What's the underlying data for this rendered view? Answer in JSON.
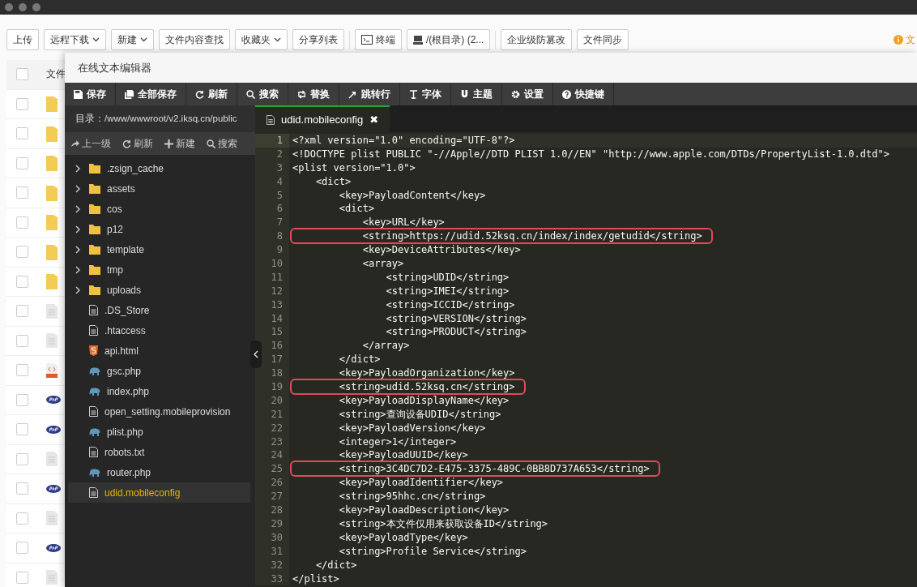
{
  "toolbar": {
    "buttons": [
      {
        "label": "上传",
        "kind": "plain"
      },
      {
        "label": "远程下载",
        "kind": "dropdown"
      },
      {
        "label": "新建",
        "kind": "dropdown"
      },
      {
        "label": "文件内容查找",
        "kind": "plain"
      },
      {
        "label": "收藏夹",
        "kind": "dropdown"
      },
      {
        "label": "分享列表",
        "kind": "plain"
      },
      {
        "label": "终端",
        "kind": "terminal"
      },
      {
        "label": "/(根目录) (2...",
        "kind": "drive"
      },
      {
        "label": "企业级防篡改",
        "kind": "plain"
      },
      {
        "label": "文件同步",
        "kind": "plain"
      }
    ],
    "notice": "文"
  },
  "file_list": {
    "header": {
      "label": "文件",
      "checked": false
    },
    "rows": [
      {
        "kind": "folder",
        "checked": false
      },
      {
        "kind": "folder",
        "checked": false
      },
      {
        "kind": "folder",
        "checked": false
      },
      {
        "kind": "folder",
        "checked": false
      },
      {
        "kind": "folder",
        "checked": false
      },
      {
        "kind": "folder",
        "checked": false
      },
      {
        "kind": "folder",
        "checked": false
      },
      {
        "kind": "file",
        "checked": false
      },
      {
        "kind": "file",
        "checked": false
      },
      {
        "kind": "html",
        "checked": false
      },
      {
        "kind": "php",
        "checked": false
      },
      {
        "kind": "php",
        "checked": false
      },
      {
        "kind": "file",
        "checked": false
      },
      {
        "kind": "php",
        "checked": false
      },
      {
        "kind": "file",
        "checked": false
      },
      {
        "kind": "php",
        "checked": false
      },
      {
        "kind": "file",
        "checked": false
      }
    ]
  },
  "editor": {
    "title": "在线文本编辑器",
    "toolbar": [
      {
        "label": "保存",
        "kind": "save"
      },
      {
        "label": "全部保存",
        "kind": "save-all"
      },
      {
        "label": "刷新",
        "kind": "refresh"
      },
      {
        "label": "搜索",
        "kind": "search"
      },
      {
        "label": "替换",
        "kind": "replace"
      },
      {
        "label": "跳转行",
        "kind": "jump"
      },
      {
        "label": "字体",
        "kind": "font"
      },
      {
        "label": "主题",
        "kind": "theme"
      },
      {
        "label": "设置",
        "kind": "settings"
      },
      {
        "label": "快捷键",
        "kind": "help"
      }
    ],
    "sidebar": {
      "path": "目录：/www/wwwroot/v2.iksq.cn/public",
      "actions": [
        {
          "label": "上一级",
          "kind": "up"
        },
        {
          "label": "刷新",
          "kind": "refresh"
        },
        {
          "label": "新建",
          "kind": "plus"
        },
        {
          "label": "搜索",
          "kind": "search"
        }
      ],
      "items": [
        {
          "name": ".zsign_cache",
          "kind": "folder",
          "expanded": false,
          "selected": false
        },
        {
          "name": "assets",
          "kind": "folder",
          "expanded": false,
          "selected": false
        },
        {
          "name": "cos",
          "kind": "folder",
          "expanded": false,
          "selected": false
        },
        {
          "name": "p12",
          "kind": "folder",
          "expanded": false,
          "selected": false
        },
        {
          "name": "template",
          "kind": "folder",
          "expanded": false,
          "selected": false
        },
        {
          "name": "tmp",
          "kind": "folder",
          "expanded": false,
          "selected": false
        },
        {
          "name": "uploads",
          "kind": "folder",
          "expanded": false,
          "selected": false
        },
        {
          "name": ".DS_Store",
          "kind": "file",
          "selected": false
        },
        {
          "name": ".htaccess",
          "kind": "file",
          "selected": false
        },
        {
          "name": "api.html",
          "kind": "html",
          "selected": false
        },
        {
          "name": "gsc.php",
          "kind": "php",
          "selected": false
        },
        {
          "name": "index.php",
          "kind": "php",
          "selected": false
        },
        {
          "name": "open_setting.mobileprovision",
          "kind": "file",
          "selected": false
        },
        {
          "name": "plist.php",
          "kind": "php",
          "selected": false
        },
        {
          "name": "robots.txt",
          "kind": "file",
          "selected": false
        },
        {
          "name": "router.php",
          "kind": "php",
          "selected": false
        },
        {
          "name": "udid.mobileconfig",
          "kind": "file",
          "selected": true
        }
      ]
    },
    "tabs": [
      {
        "label": "udid.mobileconfig",
        "close": "✖",
        "selected": true
      }
    ],
    "lines": [
      {
        "n": "1",
        "text": "<?xml version=\"1.0\" encoding=\"UTF-8\"?>",
        "active": true,
        "highlighted": false
      },
      {
        "n": "2",
        "text": "<!DOCTYPE plist PUBLIC \"-//Apple//DTD PLIST 1.0//EN\" \"http://www.apple.com/DTDs/PropertyList-1.0.dtd\">",
        "active": false,
        "highlighted": false
      },
      {
        "n": "3",
        "text": "<plist version=\"1.0\">",
        "active": false,
        "highlighted": false
      },
      {
        "n": "4",
        "text": "    <dict>",
        "active": false,
        "highlighted": false
      },
      {
        "n": "5",
        "text": "        <key>PayloadContent</key>",
        "active": false,
        "highlighted": false
      },
      {
        "n": "6",
        "text": "        <dict>",
        "active": false,
        "highlighted": false
      },
      {
        "n": "7",
        "text": "            <key>URL</key>",
        "active": false,
        "highlighted": false
      },
      {
        "n": "8",
        "text": "            <string>https://udid.52ksq.cn/index/index/getudid</string>",
        "active": false,
        "highlighted": true
      },
      {
        "n": "9",
        "text": "            <key>DeviceAttributes</key>",
        "active": false,
        "highlighted": false
      },
      {
        "n": "10",
        "text": "            <array>",
        "active": false,
        "highlighted": false
      },
      {
        "n": "11",
        "text": "                <string>UDID</string>",
        "active": false,
        "highlighted": false
      },
      {
        "n": "12",
        "text": "                <string>IMEI</string>",
        "active": false,
        "highlighted": false
      },
      {
        "n": "13",
        "text": "                <string>ICCID</string>",
        "active": false,
        "highlighted": false
      },
      {
        "n": "14",
        "text": "                <string>VERSION</string>",
        "active": false,
        "highlighted": false
      },
      {
        "n": "15",
        "text": "                <string>PRODUCT</string>",
        "active": false,
        "highlighted": false
      },
      {
        "n": "16",
        "text": "            </array>",
        "active": false,
        "highlighted": false
      },
      {
        "n": "17",
        "text": "        </dict>",
        "active": false,
        "highlighted": false
      },
      {
        "n": "18",
        "text": "        <key>PayloadOrganization</key>",
        "active": false,
        "highlighted": false
      },
      {
        "n": "19",
        "text": "        <string>udid.52ksq.cn</string>",
        "active": false,
        "highlighted": true
      },
      {
        "n": "20",
        "text": "        <key>PayloadDisplayName</key>",
        "active": false,
        "highlighted": false
      },
      {
        "n": "21",
        "text": "        <string>查询设备UDID</string>",
        "active": false,
        "highlighted": false
      },
      {
        "n": "22",
        "text": "        <key>PayloadVersion</key>",
        "active": false,
        "highlighted": false
      },
      {
        "n": "23",
        "text": "        <integer>1</integer>",
        "active": false,
        "highlighted": false
      },
      {
        "n": "24",
        "text": "        <key>PayloadUUID</key>",
        "active": false,
        "highlighted": false
      },
      {
        "n": "25",
        "text": "        <string>3C4DC7D2-E475-3375-489C-0BB8D737A653</string>",
        "active": false,
        "highlighted": true
      },
      {
        "n": "26",
        "text": "        <key>PayloadIdentifier</key>",
        "active": false,
        "highlighted": false
      },
      {
        "n": "27",
        "text": "        <string>95hhc.cn</string>",
        "active": false,
        "highlighted": false
      },
      {
        "n": "28",
        "text": "        <key>PayloadDescription</key>",
        "active": false,
        "highlighted": false
      },
      {
        "n": "29",
        "text": "        <string>本文件仅用来获取设备ID</string>",
        "active": false,
        "highlighted": false
      },
      {
        "n": "30",
        "text": "        <key>PayloadType</key>",
        "active": false,
        "highlighted": false
      },
      {
        "n": "31",
        "text": "        <string>Profile Service</string>",
        "active": false,
        "highlighted": false
      },
      {
        "n": "32",
        "text": "    </dict>",
        "active": false,
        "highlighted": false
      },
      {
        "n": "33",
        "text": "</plist>",
        "active": false,
        "highlighted": false
      }
    ]
  }
}
